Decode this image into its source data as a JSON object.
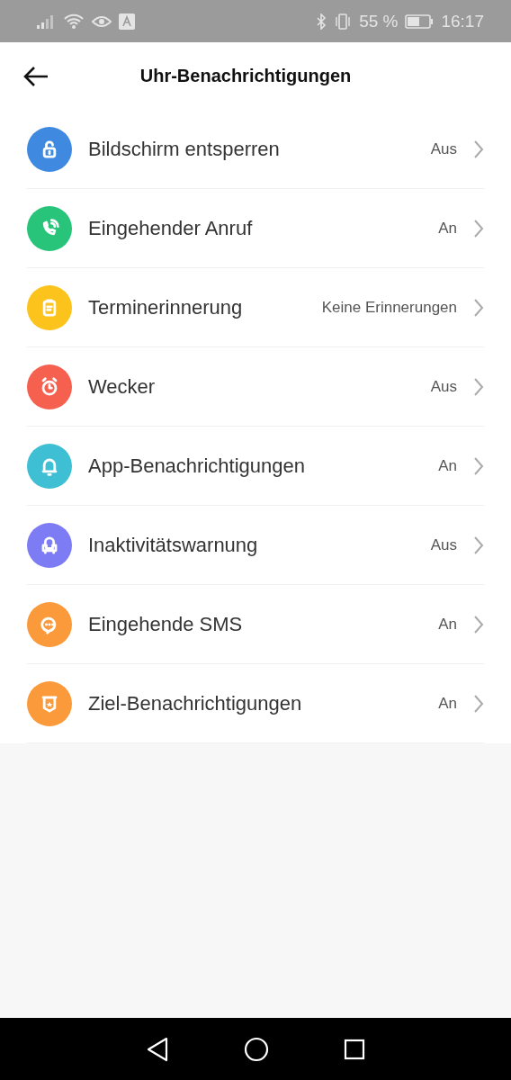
{
  "status_bar": {
    "battery": "55 %",
    "time": "16:17"
  },
  "header": {
    "title": "Uhr-Benachrichtigungen"
  },
  "items": [
    {
      "kind": "unlock",
      "color": "#3f8ae0",
      "label": "Bildschirm entsperren",
      "value": "Aus"
    },
    {
      "kind": "phone",
      "color": "#27c47a",
      "label": "Eingehender Anruf",
      "value": "An"
    },
    {
      "kind": "clipboard",
      "color": "#fcc31d",
      "label": "Terminerinnerung",
      "value": "Keine Erinnerungen"
    },
    {
      "kind": "alarm",
      "color": "#f5604f",
      "label": "Wecker",
      "value": "Aus"
    },
    {
      "kind": "bell",
      "color": "#3ebfd3",
      "label": "App-Benachrichtigungen",
      "value": "An"
    },
    {
      "kind": "armchair",
      "color": "#7d7cf4",
      "label": "Inaktivitätswarnung",
      "value": "Aus"
    },
    {
      "kind": "chat",
      "color": "#fb9a3b",
      "label": "Eingehende SMS",
      "value": "An"
    },
    {
      "kind": "badge",
      "color": "#fb9a3b",
      "label": "Ziel-Benachrichtigungen",
      "value": "An"
    }
  ]
}
